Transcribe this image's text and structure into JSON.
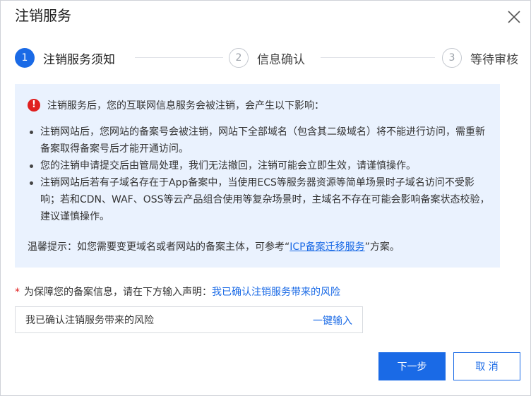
{
  "dialog": {
    "title": "注销服务",
    "close_icon": "close-icon"
  },
  "steps": [
    {
      "number": "1",
      "label": "注销服务须知",
      "state": "active"
    },
    {
      "number": "2",
      "label": "信息确认",
      "state": "inactive"
    },
    {
      "number": "3",
      "label": "等待审核",
      "state": "inactive"
    }
  ],
  "notice": {
    "icon": "warning-icon",
    "heading": "注销服务后，您的互联网信息服务会被注销，会产生以下影响：",
    "items": [
      "注销网站后，您网站的备案号会被注销，网站下全部域名（包含其二级域名）将不能进行访问，需重新备案取得备案号后才能开通访问。",
      "您的注销申请提交后由管局处理，我们无法撤回，注销可能会立即生效，请谨慎操作。",
      "注销网站后若有子域名存在于App备案中，当使用ECS等服务器资源等简单场景时子域名访问不受影响；若和CDN、WAF、OSS等云产品组合使用等复杂场景时，主域名不存在可能会影响备案状态校验，建议谨慎操作。"
    ],
    "tip_prefix": "温馨提示：如您需要变更域名或者网站的备案主体，可参考“",
    "tip_link": "ICP备案迁移服务",
    "tip_suffix": "”方案。"
  },
  "declaration": {
    "required_mark": "*",
    "label": "为保障您的备案信息，请在下方输入声明：",
    "phrase": "我已确认注销服务带来的风险",
    "input_value": "我已确认注销服务带来的风险",
    "one_click_label": "一键输入"
  },
  "footer": {
    "next_label": "下一步",
    "cancel_label": "取 消"
  },
  "colors": {
    "primary": "#1a6ae6",
    "notice_bg": "#eaf2fe",
    "danger": "#e02020"
  }
}
